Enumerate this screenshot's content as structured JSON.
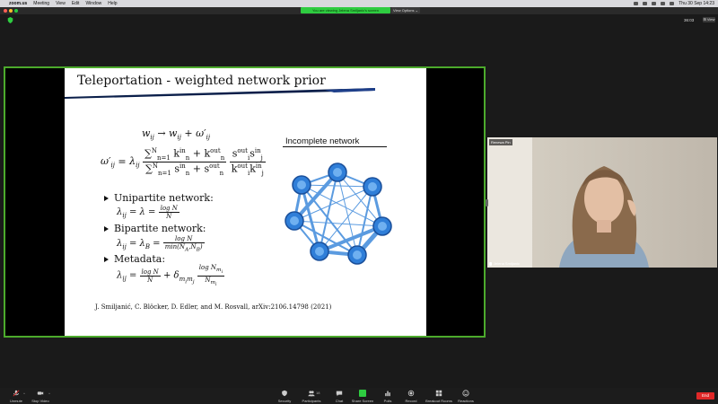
{
  "menubar": {
    "items": [
      "zoom.us",
      "Meeting",
      "View",
      "Edit",
      "Window",
      "Help"
    ],
    "clock": "Thu 30 Sep  14:23"
  },
  "share_banner": "You are viewing Jelena Smiljanic's screen",
  "view_options": "View Options ⌄",
  "meeting_timer": "36:03",
  "view_button": "⊞ View",
  "slide": {
    "title": "Teleportation - weighted network prior",
    "bullets": [
      "Unipartite network:",
      "Bipartite network:",
      "Metadata:"
    ],
    "network_title": "Incomplete network",
    "citation": "J. Smiljanić, C. Blöcker, D. Edler, and M. Rosvall, arXiv:2106.14798 (2021)",
    "accent_color": "#1f6fd1"
  },
  "participant": {
    "name_top": "Renewa Pin",
    "name_bottom": "Jelena Smiljanic"
  },
  "toolbar": {
    "unmute": "Unmute",
    "stop_video": "Stop Video",
    "security": "Security",
    "participants": "Participants",
    "participants_count": "18",
    "chat": "Chat",
    "share_screen": "Share Screen",
    "polls": "Polls",
    "record": "Record",
    "breakout_rooms": "Breakout Rooms",
    "reactions": "Reactions",
    "end": "End"
  }
}
